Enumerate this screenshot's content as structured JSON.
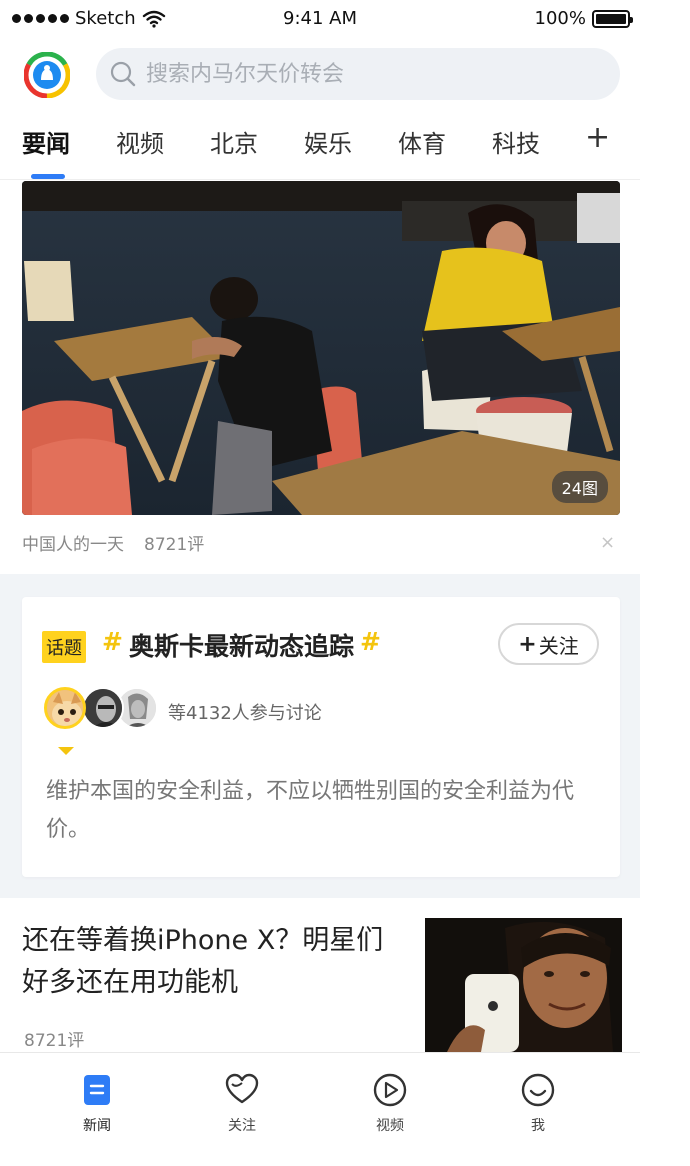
{
  "status_bar": {
    "carrier": "Sketch",
    "time": "9:41 AM",
    "battery": "100%"
  },
  "header": {
    "search_placeholder": "搜索内马尔天价转会"
  },
  "tabs": [
    {
      "label": "要闻",
      "active": true
    },
    {
      "label": "视频"
    },
    {
      "label": "北京"
    },
    {
      "label": "娱乐"
    },
    {
      "label": "体育"
    },
    {
      "label": "科技"
    }
  ],
  "tab_add_label": "+",
  "hero": {
    "image_count_badge": "24图",
    "source": "中国人的一天",
    "comments": "8721评",
    "close": "×"
  },
  "topic": {
    "tag": "话题",
    "hash": "#",
    "title": "奥斯卡最新动态追踪",
    "follow_label": "关注",
    "follow_plus": "+",
    "participants": "等4132人参与讨论",
    "quote": "维护本国的安全利益，不应以牺牲别国的安全利益为代价。"
  },
  "article": {
    "title": "还在等着换iPhone X？明星们好多还在用功能机",
    "comments": "8721评"
  },
  "bottom_nav": [
    {
      "label": "新闻",
      "icon": "news-icon",
      "active": true
    },
    {
      "label": "关注",
      "icon": "heart-icon"
    },
    {
      "label": "视频",
      "icon": "play-icon"
    },
    {
      "label": "我",
      "icon": "smile-icon"
    }
  ],
  "colors": {
    "accent": "#2e7cf6",
    "topic_yellow": "#ffd21e",
    "section_bg": "#f1f4f7"
  }
}
